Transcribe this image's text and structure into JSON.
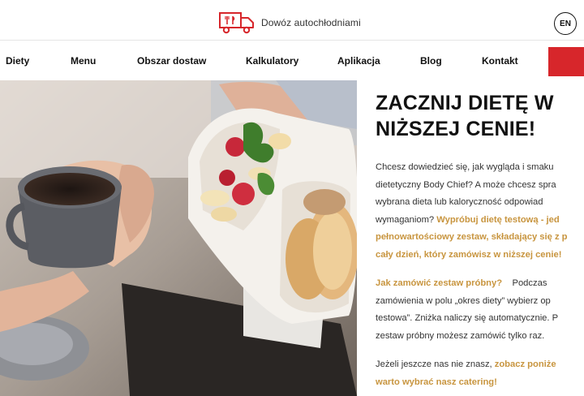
{
  "topbar": {
    "promo_icon": "delivery-truck-icon",
    "promo_text": "Dowóz autochłodniami",
    "lang_label": "EN"
  },
  "nav": {
    "items": [
      "Diety",
      "Menu",
      "Obszar dostaw",
      "Kalkulatory",
      "Aplikacja",
      "Blog",
      "Kontakt"
    ],
    "cta_color": "#d7262b"
  },
  "hero": {
    "alt": "Dłonie trzymające kubek kawy i pudełko z dietą"
  },
  "content": {
    "headline_line1": "ZACZNIJ DIETĘ W",
    "headline_line2": "NIŻSZEJ CENIE!",
    "p1": {
      "l1": "Chcesz dowiedzieć się, jak wygląda i smaku",
      "l2": "dietetyczny Body Chief? A może chcesz spra",
      "l3": "wybrana dieta lub kaloryczność odpowiad",
      "l4a": "wymaganiom?",
      "l4b": "Wypróbuj dietę testową - jed",
      "l5": "pełnowartościowy zestaw, składający się z p",
      "l6": "cały dzień, który zamówisz w niższej cenie!"
    },
    "p2": {
      "l1a": "Jak zamówić zestaw próbny?",
      "l1b": "Podczas",
      "l2": "zamówienia w polu „okres diety” wybierz op",
      "l3": "testowa”. Zniżka naliczy się automatycznie. P",
      "l4": "zestaw próbny możesz zamówić tylko raz."
    },
    "p3": {
      "l1a": "Jeżeli jeszcze nas nie znasz,",
      "l1b": "zobacz poniże",
      "l2": "warto wybrać nasz catering!"
    }
  },
  "colors": {
    "brand_red": "#d7262b",
    "accent_gold": "#c8953f"
  }
}
